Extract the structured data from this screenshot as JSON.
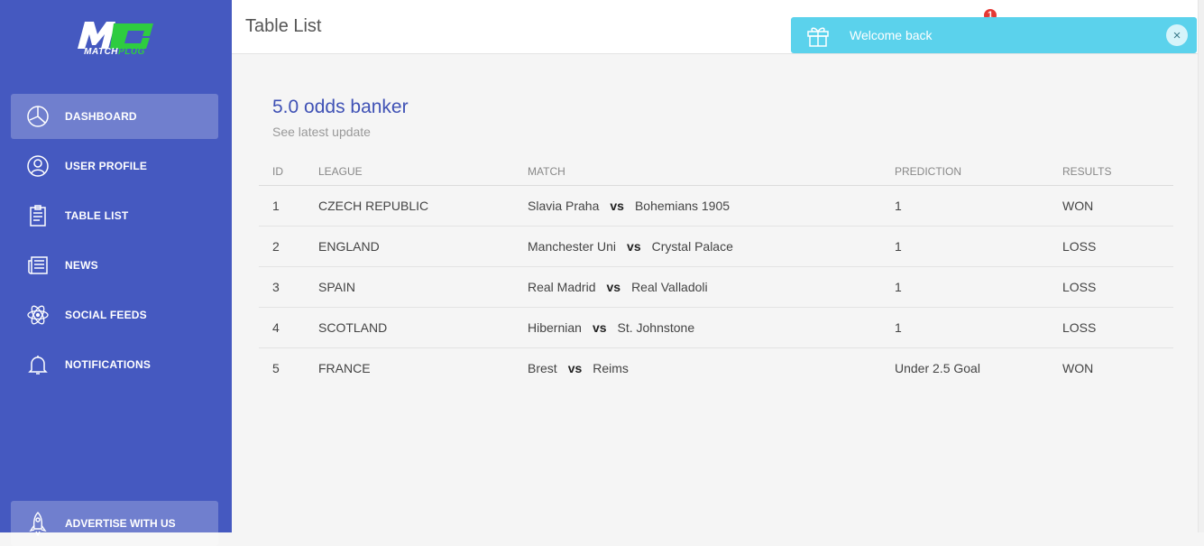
{
  "brand": {
    "logo_text_part1": "MATCH",
    "logo_text_part2": "PLUG",
    "brand_green": "#2ecc40",
    "sidebar_color": "#4559c0"
  },
  "sidebar": {
    "items": [
      {
        "label": "DASHBOARD",
        "icon": "pie-chart-icon",
        "active": true
      },
      {
        "label": "USER PROFILE",
        "icon": "user-icon"
      },
      {
        "label": "TABLE LIST",
        "icon": "clipboard-icon"
      },
      {
        "label": "NEWS",
        "icon": "newspaper-icon"
      },
      {
        "label": "SOCIAL FEEDS",
        "icon": "atom-icon"
      },
      {
        "label": "NOTIFICATIONS",
        "icon": "bell-icon"
      }
    ],
    "advertise": {
      "label": "ADVERTISE WITH US",
      "icon": "rocket-icon"
    }
  },
  "header": {
    "title": "Table List",
    "notification_count": "1"
  },
  "toast": {
    "message": "Welcome back",
    "close": "×",
    "color": "#5bd2ec"
  },
  "card": {
    "title": "5.0 odds banker",
    "subtitle": "See latest update"
  },
  "table": {
    "columns": [
      "ID",
      "LEAGUE",
      "MATCH",
      "PREDICTION",
      "RESULTS"
    ],
    "vs_label": "vs",
    "rows": [
      {
        "id": "1",
        "league": "CZECH REPUBLIC",
        "home": "Slavia Praha",
        "away": "Bohemians 1905",
        "prediction": "1",
        "result": "WON"
      },
      {
        "id": "2",
        "league": "ENGLAND",
        "home": "Manchester Uni",
        "away": "Crystal Palace",
        "prediction": "1",
        "result": "LOSS"
      },
      {
        "id": "3",
        "league": "SPAIN",
        "home": "Real Madrid",
        "away": "Real Valladoli",
        "prediction": "1",
        "result": "LOSS"
      },
      {
        "id": "4",
        "league": "SCOTLAND",
        "home": "Hibernian",
        "away": "St. Johnstone",
        "prediction": "1",
        "result": "LOSS"
      },
      {
        "id": "5",
        "league": "FRANCE",
        "home": "Brest",
        "away": "Reims",
        "prediction": "Under 2.5 Goal",
        "result": "WON"
      }
    ]
  }
}
